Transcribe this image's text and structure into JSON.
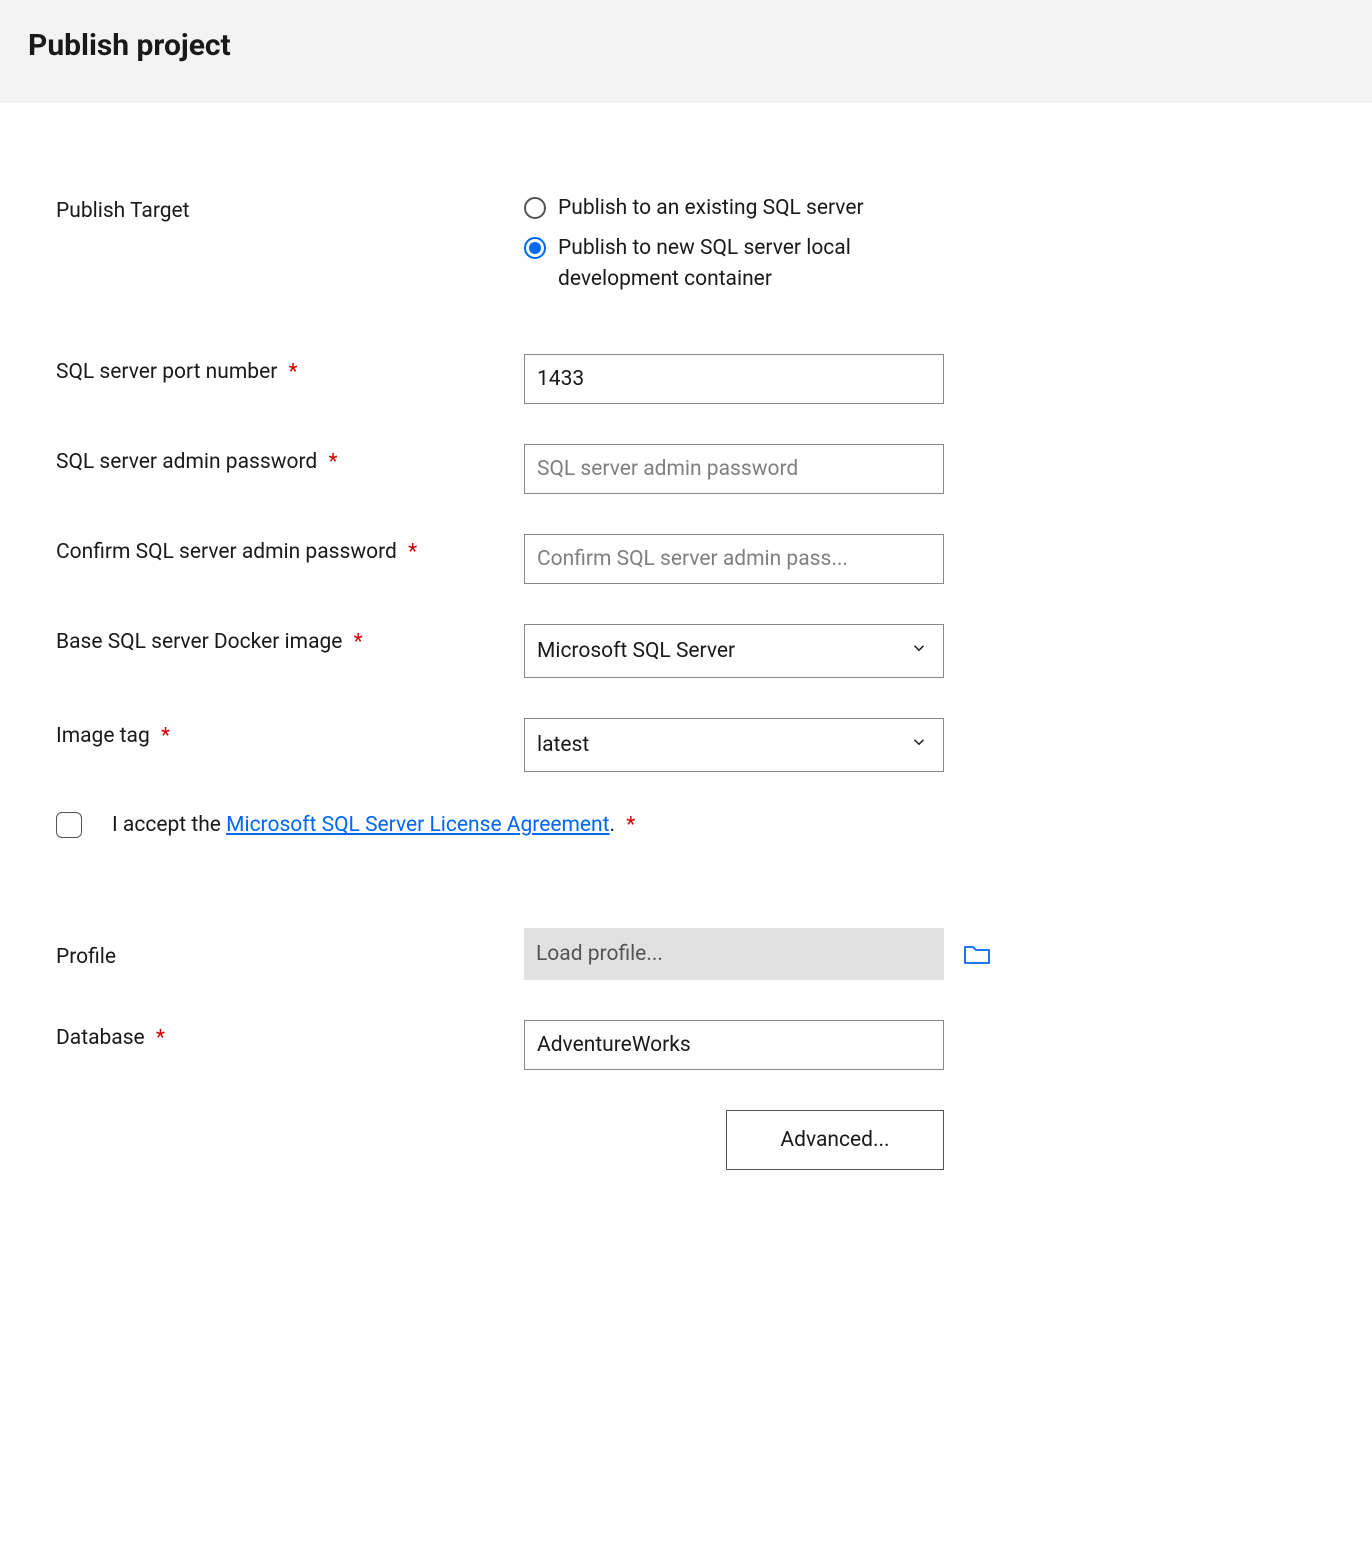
{
  "header": {
    "title": "Publish project"
  },
  "form": {
    "publishTarget": {
      "label": "Publish Target",
      "options": [
        {
          "label": "Publish to an existing SQL server",
          "checked": false
        },
        {
          "label": "Publish to new SQL server local development container",
          "checked": true
        }
      ]
    },
    "portNumber": {
      "label": "SQL server port number",
      "value": "1433"
    },
    "adminPassword": {
      "label": "SQL server admin password",
      "placeholder": "SQL server admin password"
    },
    "confirmPassword": {
      "label": "Confirm SQL server admin password",
      "placeholder": "Confirm SQL server admin pass..."
    },
    "dockerImage": {
      "label": "Base SQL server Docker image",
      "value": "Microsoft SQL Server"
    },
    "imageTag": {
      "label": "Image tag",
      "value": "latest"
    },
    "license": {
      "prefix": "I accept the ",
      "linkText": "Microsoft SQL Server License Agreement",
      "suffix": "."
    },
    "profile": {
      "label": "Profile",
      "placeholder": "Load profile..."
    },
    "database": {
      "label": "Database",
      "value": "AdventureWorks"
    },
    "advancedButton": "Advanced..."
  }
}
